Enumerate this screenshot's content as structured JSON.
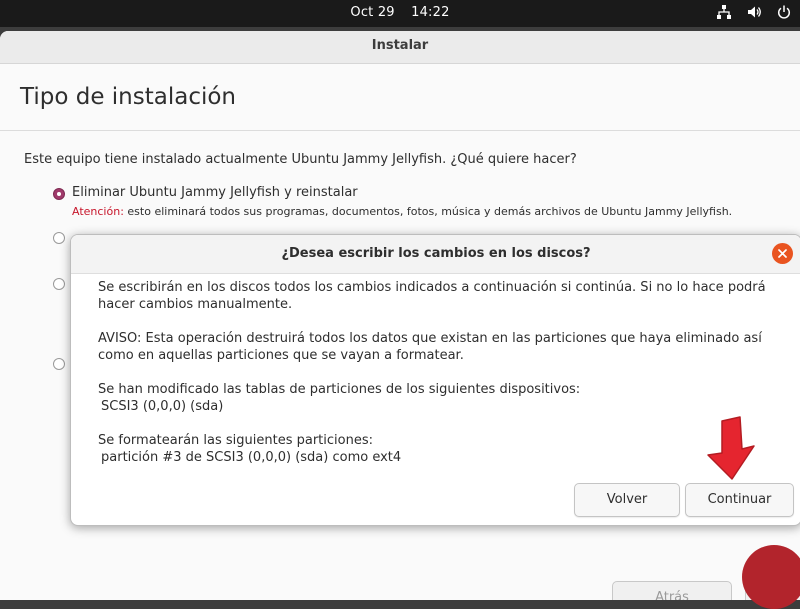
{
  "topbar": {
    "date": "Oct 29",
    "time": "14:22"
  },
  "window": {
    "title": "Instalar"
  },
  "page": {
    "title": "Tipo de instalación",
    "question": "Este equipo tiene instalado actualmente Ubuntu Jammy Jellyfish. ¿Qué quiere hacer?",
    "options": [
      {
        "label": "Eliminar Ubuntu Jammy Jellyfish y reinstalar",
        "selected": true,
        "warning_prefix": "Atención:",
        "warning_text": " esto eliminará todos sus programas, documentos, fotos, música y demás archivos de Ubuntu Jammy Jellyfish."
      },
      {
        "selected": false
      },
      {
        "selected": false
      },
      {
        "selected": false
      }
    ],
    "back_label": "Atrás"
  },
  "dialog": {
    "title": "¿Desea escribir los cambios en los discos?",
    "para1": "Se escribirán en los discos todos los cambios indicados a continuación si continúa. Si no lo hace podrá hacer cambios manualmente.",
    "para2": "AVISO: Esta operación destruirá todos los datos que existan en las particiones que haya eliminado así como en aquellas particiones que se vayan a formatear.",
    "para3_heading": "Se han modificado las tablas de particiones de los siguientes dispositivos:",
    "para3_device": "SCSI3 (0,0,0) (sda)",
    "para4_heading": "Se formatearán las siguientes particiones:",
    "para4_partition": "partición #3 de SCSI3 (0,0,0) (sda) como ext4",
    "back_button": "Volver",
    "continue_button": "Continuar"
  },
  "colors": {
    "accent": "#e95420",
    "radio_selected": "#a03a6b",
    "warning": "#c7162b",
    "arrow": "#e5252f"
  },
  "icons": [
    "network-icon",
    "volume-icon",
    "power-icon",
    "close-icon",
    "pointer-arrow-icon"
  ]
}
